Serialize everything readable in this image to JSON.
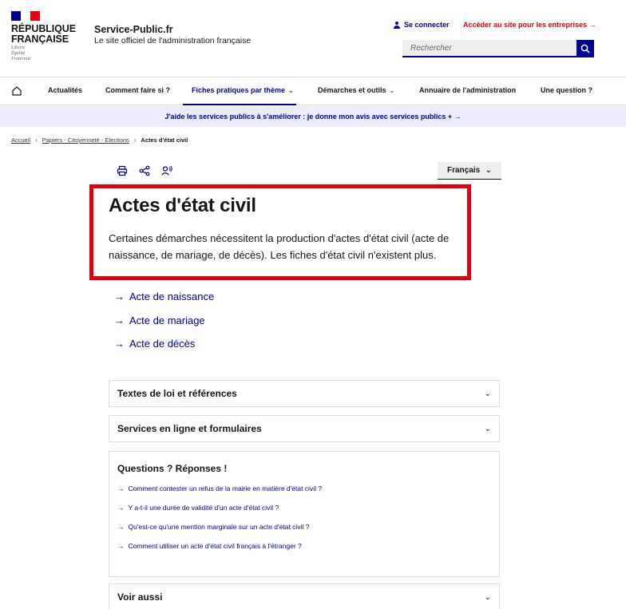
{
  "header": {
    "republic_line1": "RÉPUBLIQUE",
    "republic_line2": "FRANÇAISE",
    "motto": [
      "Liberté",
      "Égalité",
      "Fraternité"
    ],
    "site_title": "Service-Public.fr",
    "site_subtitle": "Le site officiel de l'administration française",
    "connect_label": "Se connecter",
    "enterprise_label": "Accéder au site pour les entreprises →",
    "search_placeholder": "Rechercher",
    "colors": {
      "primary": "#000091",
      "red": "#e1000f"
    }
  },
  "nav": {
    "items": [
      {
        "label": "Actualités"
      },
      {
        "label": "Comment faire si ?"
      },
      {
        "label": "Fiches pratiques par thème"
      },
      {
        "label": "Démarches et outils"
      },
      {
        "label": "Annuaire de l'administration"
      },
      {
        "label": "Une question ?"
      }
    ]
  },
  "banner": {
    "text": "J'aide les services publics à s'améliorer : je donne mon avis avec services publics + →"
  },
  "breadcrumb": {
    "items": [
      "Accueil",
      "Papiers - Citoyenneté - Élections",
      "Actes d'état civil"
    ]
  },
  "language": "Français",
  "main": {
    "title": "Actes d'état civil",
    "intro": "Certaines démarches nécessitent la production d'actes d'état civil (acte de naissance, de mariage, de décès). Les fiches d'état civil n'existent plus.",
    "links": [
      "Acte de naissance",
      "Acte de mariage",
      "Acte de décès"
    ]
  },
  "accordions": {
    "textes": "Textes de loi et références",
    "services": "Services en ligne et formulaires",
    "voir": "Voir aussi"
  },
  "qa": {
    "title": "Questions ? Réponses !",
    "items": [
      "Comment contester un refus de la mairie en matière d'état civil ?",
      "Y a-t-il une durée de validité d'un acte d'état civil ?",
      "Qu'est-ce qu'une mention marginale sur un acte d'état civil ?",
      "Comment utiliser un acte d'état civil français à l'étranger ?"
    ]
  }
}
